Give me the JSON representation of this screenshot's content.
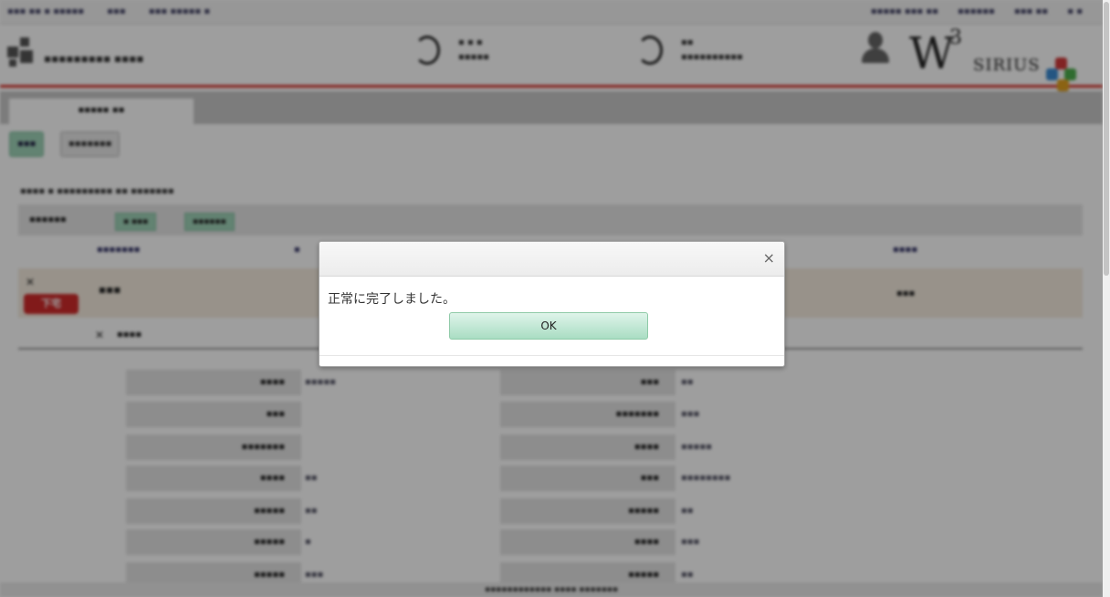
{
  "dialog": {
    "message": "正常に完了しました。",
    "ok_label": "OK",
    "close_glyph": "×"
  },
  "background": {
    "flag_label": "下宅"
  },
  "colors": {
    "header_accent": "#d9332b",
    "ok_button": "#a9ddc3",
    "flag": "#d02b2b"
  }
}
